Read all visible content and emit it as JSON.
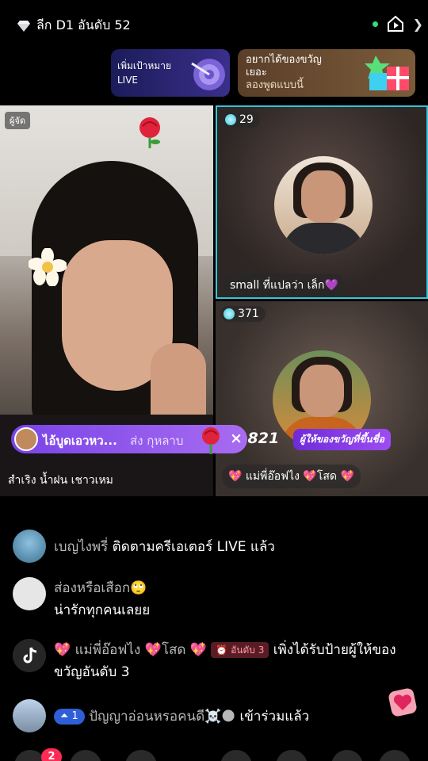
{
  "header": {
    "league_text": "ลีก D1 อันดับ 52"
  },
  "banners": {
    "goal": {
      "line1": "เพิ่มเป้าหมาย",
      "line2": "LIVE"
    },
    "gift": {
      "line1": "อยากได้ของขวัญ",
      "line2": "เยอะ",
      "line3": "ลองพูดแบบนี้"
    }
  },
  "host": {
    "tag": "ผู้จัด",
    "name": "สำเริง น้ำฝน เชาวเหม"
  },
  "guests": [
    {
      "viewers": "29",
      "name": "small ที่แปลว่า เล็ก💜"
    },
    {
      "viewers": "371",
      "name": "💖 แม่พี่อ๊อฟไง 💖โสด 💖"
    }
  ],
  "gift_combo": {
    "sender": "ไอ้บูดเอวหว...",
    "action": "ส่ง กุหลาบ",
    "count": "× 821",
    "badge": "ผู้ให้ของขวัญที่ขึ้นชื่อ"
  },
  "chat": [
    {
      "user": "เบญไงพรี่",
      "text": " ติดตามครีเอเตอร์ LIVE แล้ว"
    },
    {
      "user": "ส่องหรือเสือก🙄",
      "text": "น่ารักทุกคนเลยย"
    },
    {
      "user": "💖 แม่พี่อ๊อฟไง 💖โสด 💖",
      "rank": "⏰ อันดับ 3",
      "text": " เพิ่งได้รับป้ายผู้ให้ของขวัญอันดับ 3"
    },
    {
      "level": "⏶ 1",
      "user": " ปัญญาอ่อนหรอคนดี☠️🌑",
      "text": " เข้าร่วมแล้ว"
    }
  ],
  "bottom": {
    "notification_count": "2"
  },
  "colors": {
    "guest_border": "#38c4d8",
    "combo_purple": "#7a43e8",
    "notification_red": "#ff2a55",
    "online_green": "#2ee07a"
  }
}
